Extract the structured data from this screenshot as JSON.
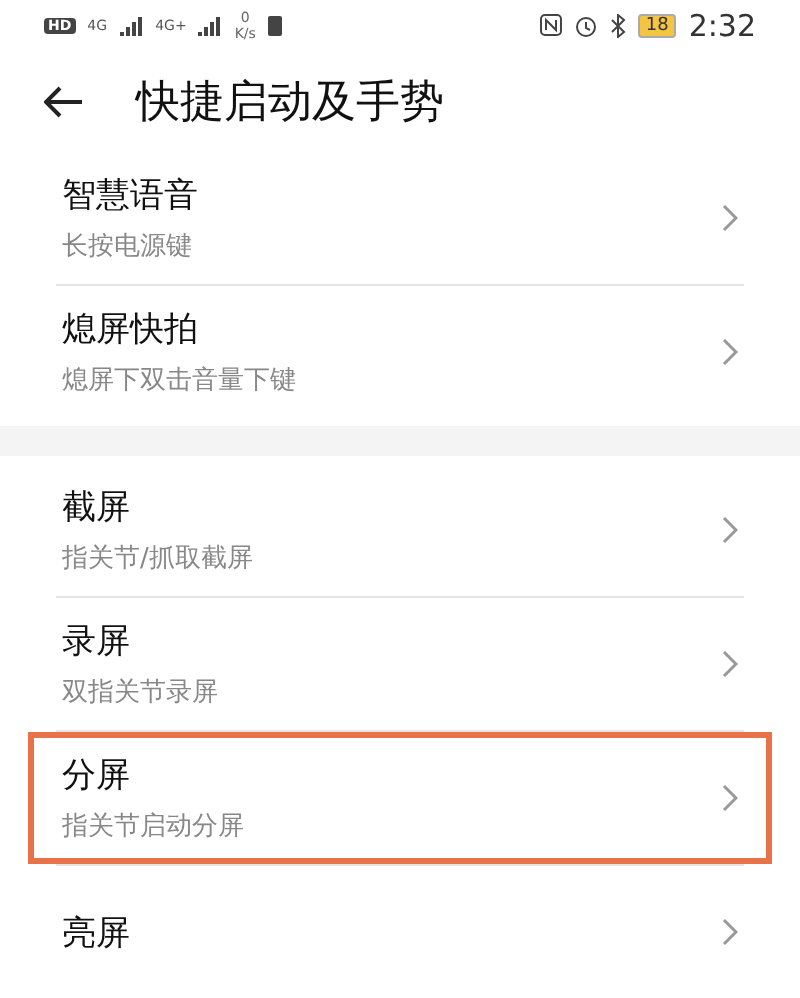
{
  "status_bar": {
    "hd": "HD",
    "networks": [
      "4G",
      "4G+"
    ],
    "speed_value": "0",
    "speed_unit": "K/s",
    "battery": "18",
    "time": "2:32"
  },
  "header": {
    "title": "快捷启动及手势"
  },
  "groups": [
    {
      "rows": [
        {
          "title": "智慧语音",
          "subtitle": "长按电源键",
          "highlighted": false
        },
        {
          "title": "熄屏快拍",
          "subtitle": "熄屏下双击音量下键",
          "highlighted": false
        }
      ]
    },
    {
      "rows": [
        {
          "title": "截屏",
          "subtitle": "指关节/抓取截屏",
          "highlighted": false
        },
        {
          "title": "录屏",
          "subtitle": "双指关节录屏",
          "highlighted": false
        },
        {
          "title": "分屏",
          "subtitle": "指关节启动分屏",
          "highlighted": true
        },
        {
          "title": "亮屏",
          "highlighted": false
        }
      ]
    }
  ]
}
